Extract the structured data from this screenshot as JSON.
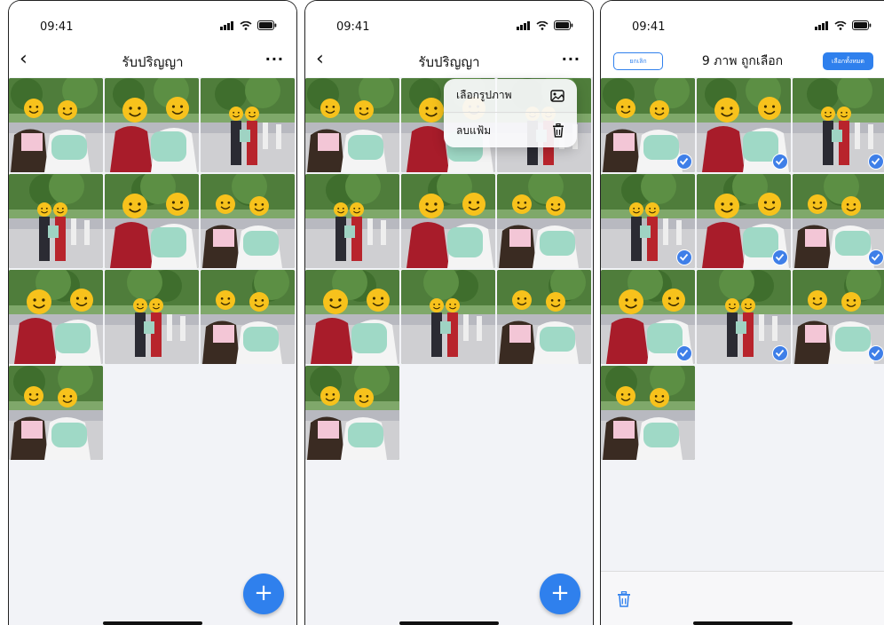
{
  "screens": {
    "album": {
      "time": "09:41",
      "title": "รับปริญญา",
      "back_icon": "chevron-left-icon",
      "more_label": "...",
      "fab_label": "+"
    },
    "menu_screen": {
      "time": "09:41",
      "title": "รับปริญญา",
      "more_label": "...",
      "fab_label": "+",
      "menu": [
        {
          "label": "เลือกรูปภาพ",
          "icon": "image-icon"
        },
        {
          "label": "ลบแฟ้ม",
          "icon": "trash-icon"
        }
      ]
    },
    "select_screen": {
      "time": "09:41",
      "cancel_label": "ยกเลิก",
      "title": "9 ภาพ ถูกเลือก",
      "select_all_label": "เลือกทั้งหมด",
      "bottom_icon": "trash-icon"
    }
  },
  "photos": [
    {
      "variant": "pair",
      "selected": true
    },
    {
      "variant": "pair-close",
      "selected": true
    },
    {
      "variant": "pair-far",
      "selected": true
    },
    {
      "variant": "pair-far",
      "selected": true
    },
    {
      "variant": "pair-close",
      "selected": true
    },
    {
      "variant": "pair",
      "selected": true
    },
    {
      "variant": "pair-close",
      "selected": true
    },
    {
      "variant": "pair-far",
      "selected": true
    },
    {
      "variant": "pair",
      "selected": true
    },
    {
      "variant": "pair",
      "selected": false
    }
  ],
  "colors": {
    "accent": "#2f80ed",
    "check": "#3f7fe8",
    "background": "#f2f3f7"
  }
}
